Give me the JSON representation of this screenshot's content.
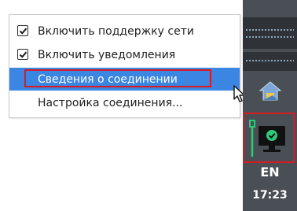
{
  "menu": {
    "items": [
      {
        "label": "Включить поддержку сети",
        "checked": true
      },
      {
        "label": "Включить уведомления",
        "checked": true
      },
      {
        "label": "Сведения о соединении",
        "checked": false,
        "selected": true
      },
      {
        "label": "Настройка соединения...",
        "checked": false
      }
    ]
  },
  "taskbar": {
    "language": "EN",
    "clock": "17:23"
  },
  "icons": {
    "cursor": "mouse-pointer-icon",
    "tray_app": "house-network-icon",
    "network": "network-connected-icon"
  },
  "colors": {
    "selection": "#3a86e2",
    "annotation_red": "#d81b22",
    "taskbar": "#4a4f55",
    "network_green": "#2ec97a"
  }
}
